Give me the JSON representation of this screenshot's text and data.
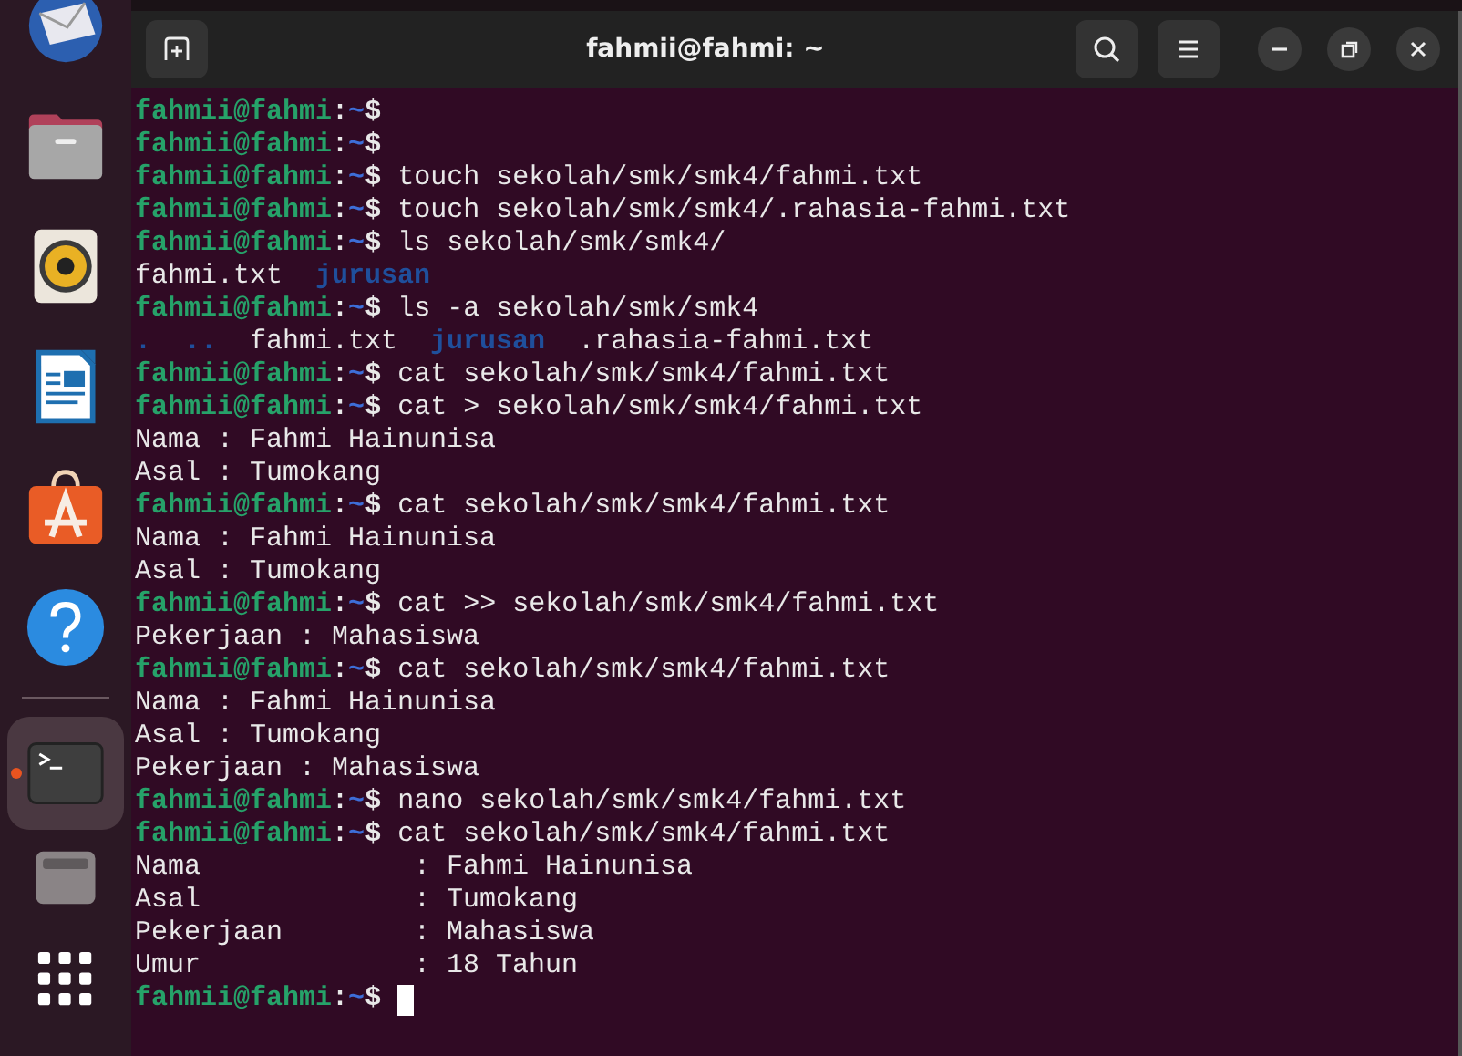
{
  "window": {
    "title": "fahmii@fahmi: ~"
  },
  "dock": [
    {
      "kind": "mail",
      "selected": false
    },
    {
      "kind": "folder",
      "selected": false
    },
    {
      "kind": "speaker",
      "selected": false
    },
    {
      "kind": "document",
      "selected": false
    },
    {
      "kind": "store",
      "selected": false
    },
    {
      "kind": "help",
      "selected": false
    },
    {
      "kind": "separator"
    },
    {
      "kind": "terminal",
      "selected": true
    },
    {
      "kind": "drive",
      "selected": false
    },
    {
      "kind": "grid",
      "selected": false
    }
  ],
  "terminal": {
    "lines": [
      {
        "kind": "prompt",
        "user": "fahmii@fahmi",
        "sep": ":",
        "path": "~",
        "symbol": "$"
      },
      {
        "kind": "prompt",
        "user": "fahmii@fahmi",
        "sep": ":",
        "path": "~",
        "symbol": "$"
      },
      {
        "kind": "prompt",
        "user": "fahmii@fahmi",
        "sep": ":",
        "path": "~",
        "symbol": "$",
        "command": "touch sekolah/smk/smk4/fahmi.txt"
      },
      {
        "kind": "prompt",
        "user": "fahmii@fahmi",
        "sep": ":",
        "path": "~",
        "symbol": "$",
        "command": "touch sekolah/smk/smk4/.rahasia-fahmi.txt"
      },
      {
        "kind": "prompt",
        "user": "fahmii@fahmi",
        "sep": ":",
        "path": "~",
        "symbol": "$",
        "command": "ls sekolah/smk/smk4/"
      },
      {
        "kind": "listing",
        "items": [
          {
            "name": "fahmi.txt",
            "kind": "file"
          },
          {
            "name": "jurusan",
            "kind": "dir"
          }
        ]
      },
      {
        "kind": "prompt",
        "user": "fahmii@fahmi",
        "sep": ":",
        "path": "~",
        "symbol": "$",
        "command": "ls -a sekolah/smk/smk4"
      },
      {
        "kind": "listing",
        "items": [
          {
            "name": ".",
            "kind": "dir"
          },
          {
            "name": "..",
            "kind": "dir"
          },
          {
            "name": "fahmi.txt",
            "kind": "file"
          },
          {
            "name": "jurusan",
            "kind": "dir"
          },
          {
            "name": ".rahasia-fahmi.txt",
            "kind": "file"
          }
        ]
      },
      {
        "kind": "prompt",
        "user": "fahmii@fahmi",
        "sep": ":",
        "path": "~",
        "symbol": "$",
        "command": "cat sekolah/smk/smk4/fahmi.txt"
      },
      {
        "kind": "prompt",
        "user": "fahmii@fahmi",
        "sep": ":",
        "path": "~",
        "symbol": "$",
        "command": "cat > sekolah/smk/smk4/fahmi.txt"
      },
      {
        "kind": "output",
        "text": "Nama : Fahmi Hainunisa"
      },
      {
        "kind": "output",
        "text": "Asal : Tumokang"
      },
      {
        "kind": "prompt",
        "user": "fahmii@fahmi",
        "sep": ":",
        "path": "~",
        "symbol": "$",
        "command": "cat sekolah/smk/smk4/fahmi.txt"
      },
      {
        "kind": "output",
        "text": "Nama : Fahmi Hainunisa"
      },
      {
        "kind": "output",
        "text": "Asal : Tumokang"
      },
      {
        "kind": "prompt",
        "user": "fahmii@fahmi",
        "sep": ":",
        "path": "~",
        "symbol": "$",
        "command": "cat >> sekolah/smk/smk4/fahmi.txt"
      },
      {
        "kind": "output",
        "text": "Pekerjaan : Mahasiswa"
      },
      {
        "kind": "prompt",
        "user": "fahmii@fahmi",
        "sep": ":",
        "path": "~",
        "symbol": "$",
        "command": "cat sekolah/smk/smk4/fahmi.txt"
      },
      {
        "kind": "output",
        "text": "Nama : Fahmi Hainunisa"
      },
      {
        "kind": "output",
        "text": "Asal : Tumokang"
      },
      {
        "kind": "output",
        "text": "Pekerjaan : Mahasiswa"
      },
      {
        "kind": "prompt",
        "user": "fahmii@fahmi",
        "sep": ":",
        "path": "~",
        "symbol": "$",
        "command": "nano sekolah/smk/smk4/fahmi.txt"
      },
      {
        "kind": "prompt",
        "user": "fahmii@fahmi",
        "sep": ":",
        "path": "~",
        "symbol": "$",
        "command": "cat sekolah/smk/smk4/fahmi.txt"
      },
      {
        "kind": "output",
        "text": "Nama             : Fahmi Hainunisa"
      },
      {
        "kind": "output",
        "text": "Asal             : Tumokang"
      },
      {
        "kind": "output",
        "text": "Pekerjaan        : Mahasiswa"
      },
      {
        "kind": "output",
        "text": "Umur             : 18 Tahun"
      },
      {
        "kind": "prompt",
        "user": "fahmii@fahmi",
        "sep": ":",
        "path": "~",
        "symbol": "$",
        "cursor": true
      }
    ]
  }
}
